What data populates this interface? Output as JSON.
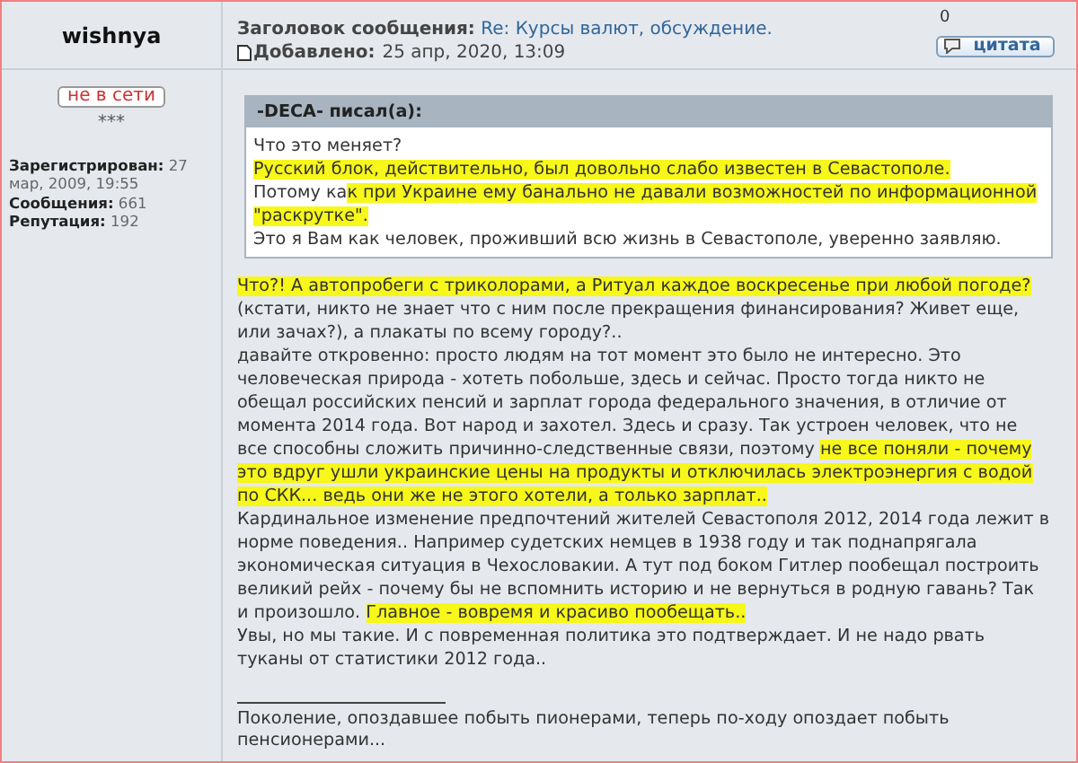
{
  "author": {
    "name": "wishnya",
    "status_button": "не в сети",
    "rank": "***",
    "details": [
      {
        "label": "Зарегистрирован:",
        "value": "27 мар, 2009, 19:55"
      },
      {
        "label": "Сообщения:",
        "value": "661"
      },
      {
        "label": "Репутация:",
        "value": "192"
      }
    ]
  },
  "header": {
    "subject_label": "Заголовок сообщения:",
    "subject": "Re: Курсы валют, обсуждение.",
    "posted_label": "Добавлено:",
    "posted": "25 апр, 2020, 13:09",
    "count": "0",
    "quote_button": "цитата"
  },
  "quote": {
    "title": "-DECA- писал(а):",
    "lines": [
      [
        {
          "text": "Что это меняет?",
          "highlighted": false
        }
      ],
      [
        {
          "text": "Русский блок, действительно, был довольно слабо известен в Севастополе.",
          "highlighted": true
        }
      ],
      [
        {
          "text": "Потому ка",
          "highlighted": false
        },
        {
          "text": "к при Украине ему банально не давали возможностей по информационной",
          "highlighted": true
        }
      ],
      [
        {
          "text": "\"раскрутке\".",
          "highlighted": true
        }
      ],
      [
        {
          "text": "Это я Вам как человек, проживший всю жизнь в Севастополе, уверенно заявляю.",
          "highlighted": false
        }
      ]
    ]
  },
  "body": [
    [
      {
        "text": "Что?! А автопробеги с триколорами, а Ритуал каждое воскресенье при любой погоде?",
        "highlighted": true
      }
    ],
    [
      {
        "text": "(кстати, никто не знает что с ним после прекращения финансирования? Живет еще,",
        "highlighted": false
      }
    ],
    [
      {
        "text": "или зачах?), а плакаты по всему городу?..",
        "highlighted": false
      }
    ],
    [
      {
        "text": "давайте откровенно: просто людям на тот момент это было не интересно. Это",
        "highlighted": false
      }
    ],
    [
      {
        "text": "человеческая природа - хотеть побольше, здесь и сейчас. Просто тогда никто не",
        "highlighted": false
      }
    ],
    [
      {
        "text": "обещал российских пенсий и зарплат города федерального значения, в отличие от",
        "highlighted": false
      }
    ],
    [
      {
        "text": "момента 2014 года. Вот народ и захотел. Здесь и сразу. Так устроен человек, что не",
        "highlighted": false
      }
    ],
    [
      {
        "text": "все способны сложить причинно-следственные связи, поэтому ",
        "highlighted": false
      },
      {
        "text": "не все поняли - почему",
        "highlighted": true
      }
    ],
    [
      {
        "text": "это вдруг ушли украинские цены на продукты и отключилась электроэнергия с водой",
        "highlighted": true
      }
    ],
    [
      {
        "text": "по СКК... ведь они же не этого хотели, а только зарплат..",
        "highlighted": true
      }
    ],
    [
      {
        "text": "Кардинальное изменение предпочтений жителей Севастополя 2012, 2014 года лежит в",
        "highlighted": false
      }
    ],
    [
      {
        "text": "норме поведения.. Например судетских немцев в 1938 году и так поднапрягала",
        "highlighted": false
      }
    ],
    [
      {
        "text": "экономическая ситуация в Чехословакии. А тут под боком Гитлер пообещал построить",
        "highlighted": false
      }
    ],
    [
      {
        "text": "великий рейх - почему бы не вспомнить историю и не вернуться в родную гавань? Так",
        "highlighted": false
      }
    ],
    [
      {
        "text": "и произошло. ",
        "highlighted": false
      },
      {
        "text": "Главное - вовремя и красиво пообещать..",
        "highlighted": true
      }
    ],
    [
      {
        "text": "Увы, но мы такие. И с повременная политика это подтверждает. И не надо рвать",
        "highlighted": false
      }
    ],
    [
      {
        "text": "туканы от статистики 2012 года..",
        "highlighted": false
      }
    ]
  ],
  "signature": [
    "Поколение, опоздавшее побыть пионерами, теперь по-ходу опоздает побыть",
    "пенсионерами..."
  ]
}
